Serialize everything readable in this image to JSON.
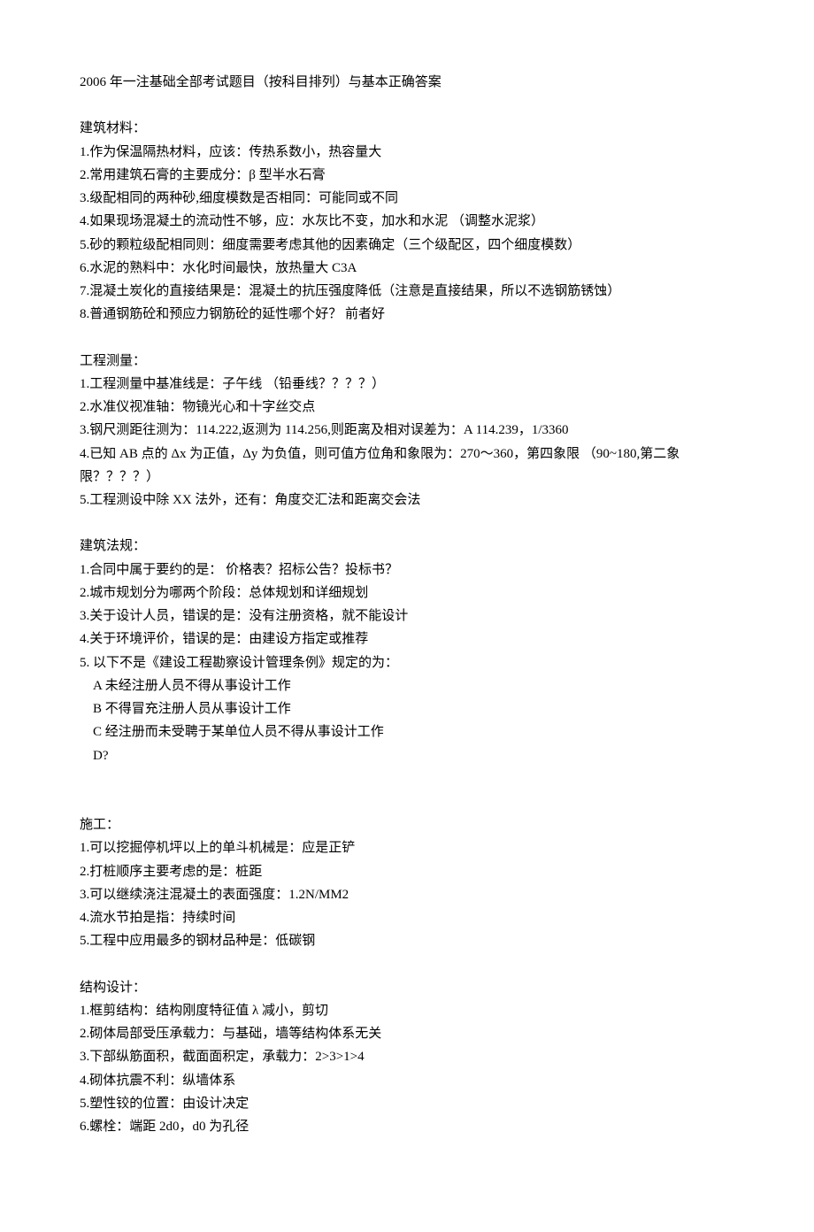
{
  "title": "2006 年一注基础全部考试题目（按科目排列）与基本正确答案",
  "sections": [
    {
      "heading": "建筑材料：",
      "items": [
        "1.作为保温隔热材料，应该：传热系数小，热容量大",
        "2.常用建筑石膏的主要成分：β 型半水石膏",
        "3.级配相同的两种砂,细度模数是否相同：可能同或不同",
        "4.如果现场混凝土的流动性不够，应：水灰比不变，加水和水泥 （调整水泥浆）",
        "5.砂的颗粒级配相同则：细度需要考虑其他的因素确定（三个级配区，四个细度模数）",
        "6.水泥的熟料中：水化时间最快，放热量大 C3A",
        "7.混凝土炭化的直接结果是：混凝土的抗压强度降低（注意是直接结果，所以不选钢筋锈蚀）",
        "8.普通钢筋砼和预应力钢筋砼的延性哪个好？   前者好"
      ]
    },
    {
      "heading": "工程测量：",
      "items": [
        "1.工程测量中基准线是：子午线 （铅垂线？？？？）",
        "2.水准仪视准轴：物镜光心和十字丝交点",
        "3.钢尺测距往测为：114.222,返测为 114.256,则距离及相对误差为：A 114.239，1/3360",
        "4.已知 AB 点的 Δx 为正值，Δy 为负值，则可值方位角和象限为：270～360，第四象限 （90~180,第二象限？？？？）",
        "5.工程测设中除 XX 法外，还有：角度交汇法和距离交会法"
      ]
    },
    {
      "heading": "建筑法规：",
      "items": [
        "1.合同中属于要约的是：   价格表？招标公告？投标书？",
        "2.城市规划分为哪两个阶段：总体规划和详细规划",
        "3.关于设计人员，错误的是：没有注册资格，就不能设计",
        "4.关于环境评价，错误的是：由建设方指定或推荐",
        "5. 以下不是《建设工程勘察设计管理条例》规定的为："
      ],
      "subitems": [
        "A 未经注册人员不得从事设计工作",
        "B 不得冒充注册人员从事设计工作",
        "C 经注册而未受聘于某单位人员不得从事设计工作",
        "D?"
      ]
    },
    {
      "heading": "施工：",
      "items": [
        "1.可以挖掘停机坪以上的单斗机械是：应是正铲",
        "2.打桩顺序主要考虑的是：桩距",
        "3.可以继续浇注混凝土的表面强度：1.2N/MM2",
        "4.流水节拍是指：持续时间",
        "5.工程中应用最多的钢材品种是：低碳钢"
      ],
      "leadingBlank": true
    },
    {
      "heading": "结构设计：",
      "items": [
        "1.框剪结构：结构刚度特征值 λ 减小，剪切",
        "2.砌体局部受压承载力：与基础，墙等结构体系无关",
        "3.下部纵筋面积，截面面积定，承载力：2>3>1>4",
        "4.砌体抗震不利：纵墙体系",
        "5.塑性铰的位置：由设计决定",
        "6.螺栓：端距 2d0，d0 为孔径"
      ]
    }
  ]
}
